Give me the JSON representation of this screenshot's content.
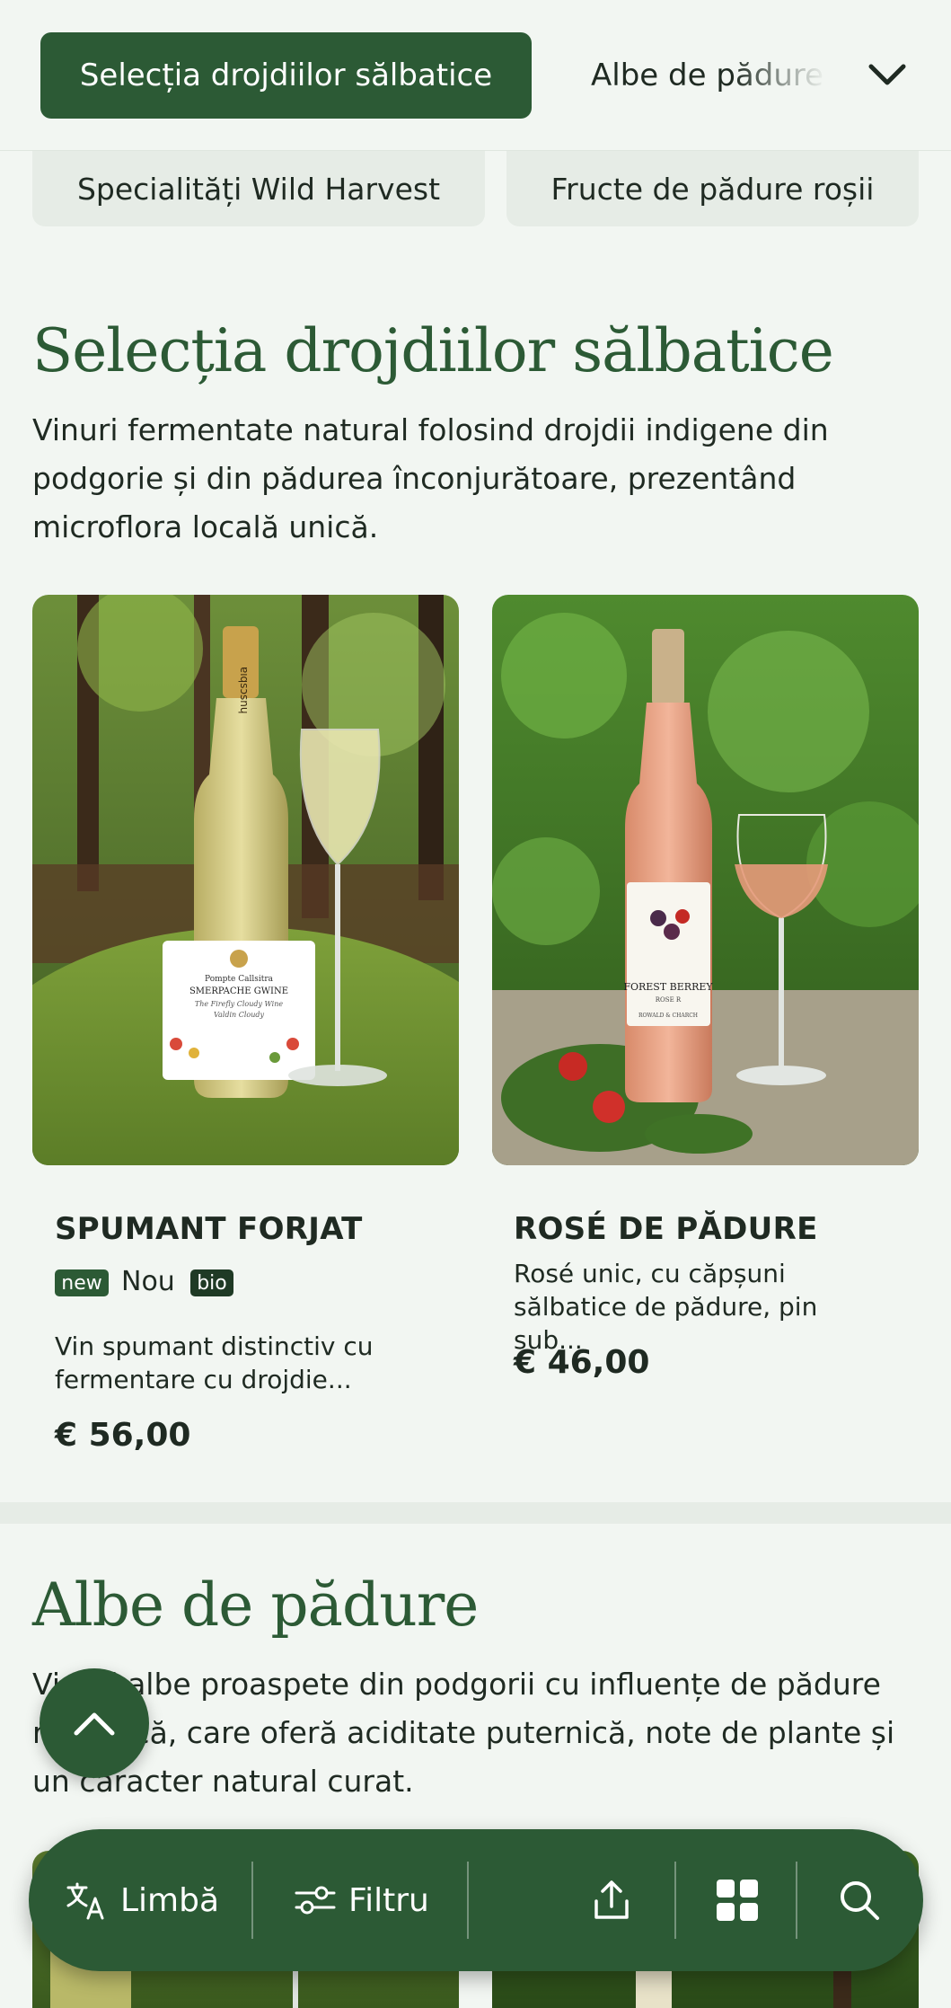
{
  "topbar": {
    "active_category": "Selecția drojdiilor sălbatice",
    "next_category": "Albe de pădure"
  },
  "pills": [
    "Specialități Wild Harvest",
    "Fructe de pădure roșii"
  ],
  "section1": {
    "title": "Selecția drojdiilor sălbatice",
    "description": "Vinuri fermentate natural folosind drojdii indigene din podgorie și din pădurea înconjurătoare, prezentând microflora locală unică."
  },
  "products": [
    {
      "name": "SPUMANT FORJAT",
      "badges": {
        "new": "new",
        "nou": "Nou",
        "bio": "bio"
      },
      "description": "Vin spumant distinctiv cu fermentare cu drojdie...",
      "price": "€ 56,00",
      "label_lines": [
        "Pompte Callsitra",
        "SMERPACHE GWINE",
        "The Firefly Cloudy Wine",
        "Valdin Cloudy"
      ],
      "capsule_text": "ɐıqsɔsnɥ"
    },
    {
      "name": "ROSÉ DE PĂDURE",
      "description": "Rosé unic, cu căpșuni sălbatice de pădure, pin sub...",
      "price": "€ 46,00",
      "label_lines": [
        "FOREST BERREY",
        "ROSE R",
        "ROWALD & CHARCH"
      ]
    }
  ],
  "section2": {
    "title": "Albe de pădure",
    "description": "Vinuri albe proaspete din podgorii cu influențe de pădure rănească, care oferă aciditate puternică, note de plante și un caracter natural curat."
  },
  "toolbar": {
    "language_label": "Limbă",
    "filter_label": "Filtru"
  },
  "colors": {
    "brand_green": "#2c5a35",
    "background": "#f2f6f2",
    "text": "#1f2a22"
  },
  "icons": [
    "chevron-down-icon",
    "arrow-up-icon",
    "translate-icon",
    "filter-sliders-icon",
    "share-icon",
    "grid-icon",
    "search-icon"
  ]
}
